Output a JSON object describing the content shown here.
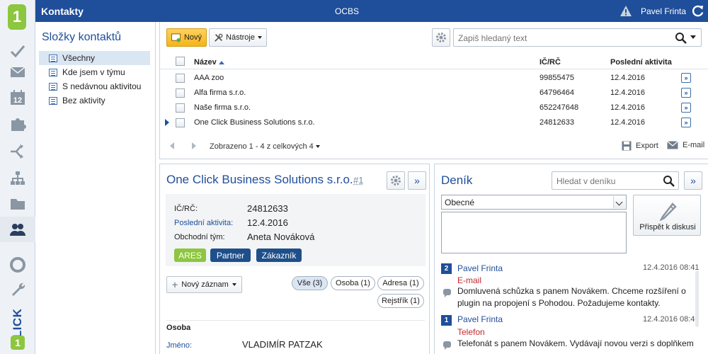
{
  "app": {
    "title": "Kontakty",
    "center": "OCBS",
    "user": "Pavel Frinta"
  },
  "rail": {
    "logo": "1",
    "brand_top": "1",
    "brand_text": "CLICK",
    "icons": [
      "check-icon",
      "mail-icon",
      "calendar-icon",
      "puzzle-icon",
      "arrows-icon",
      "org-chart-icon",
      "folder-icon",
      "people-icon",
      "lifebuoy-icon",
      "wrench-icon"
    ],
    "calendar_day": "12"
  },
  "folders": {
    "title": "Složky kontaktů",
    "items": [
      {
        "label": "Všechny"
      },
      {
        "label": "Kde jsem v týmu"
      },
      {
        "label": "S nedávnou aktivitou"
      },
      {
        "label": "Bez aktivity"
      }
    ]
  },
  "toolbar": {
    "new_label": "Nový",
    "tools_label": "Nástroje",
    "search_placeholder": "Zapiš hledaný text"
  },
  "table": {
    "headers": {
      "name": "Název",
      "ic": "IČ/RČ",
      "activity": "Poslední aktivita"
    },
    "rows": [
      {
        "name": "AAA zoo",
        "ic": "99855475",
        "activity": "12.4.2016"
      },
      {
        "name": "Alfa firma s.r.o.",
        "ic": "64796464",
        "activity": "12.4.2016"
      },
      {
        "name": "Naše firma s.r.o.",
        "ic": "652247648",
        "activity": "12.4.2016"
      },
      {
        "name": "One Click Business Solutions s.r.o.",
        "ic": "24812633",
        "activity": "12.4.2016"
      }
    ],
    "pager_text": "Zobrazeno 1 - 4 z celkových 4",
    "export_label": "Export",
    "email_label": "E-mail"
  },
  "detail": {
    "title": "One Click Business Solutions s.r.o.",
    "number": "#1",
    "fields": {
      "ic_label": "IČ/RČ:",
      "ic_value": "24812633",
      "activity_label": "Poslední aktivita:",
      "activity_value": "12.4.2016",
      "team_label": "Obchodní tým:",
      "team_value": "Aneta Nováková"
    },
    "badges": [
      {
        "label": "ARES",
        "color": "#8dc63f"
      },
      {
        "label": "Partner",
        "color": "#1e4f8a"
      },
      {
        "label": "Zákazník",
        "color": "#1e4f8a"
      }
    ],
    "new_record_label": "Nový záznam",
    "filters": [
      {
        "label": "Vše (3)"
      },
      {
        "label": "Osoba (1)"
      },
      {
        "label": "Adresa (1)"
      },
      {
        "label": "Rejstřík (1)"
      }
    ],
    "person_heading": "Osoba",
    "person_label": "Jméno:",
    "person_value": "VLADIMÍR PATZAK"
  },
  "journal": {
    "title": "Deník",
    "search_placeholder": "Hledat v deníku",
    "select_value": "Obecné",
    "post_label": "Přispět k diskusi",
    "entries": [
      {
        "num": "2",
        "author": "Pavel Frinta",
        "time": "12.4.2016 08:41",
        "type": "E-mail",
        "text": "Domluvená schůzka s panem Novákem. Chceme rozšíření o plugin na propojení s Pohodou. Požadujeme kontakty."
      },
      {
        "num": "1",
        "author": "Pavel Frinta",
        "time": "12.4.2016 08:40",
        "type": "Telefon",
        "text": "Telefonát s panem Novákem. Vydávají novou verzi s doplňkem"
      }
    ]
  },
  "colors": {
    "brand_blue": "#1f4e9a",
    "accent_green": "#8dc63f",
    "new_button": "#f5b518",
    "entry_type_red": "#c0282e"
  }
}
